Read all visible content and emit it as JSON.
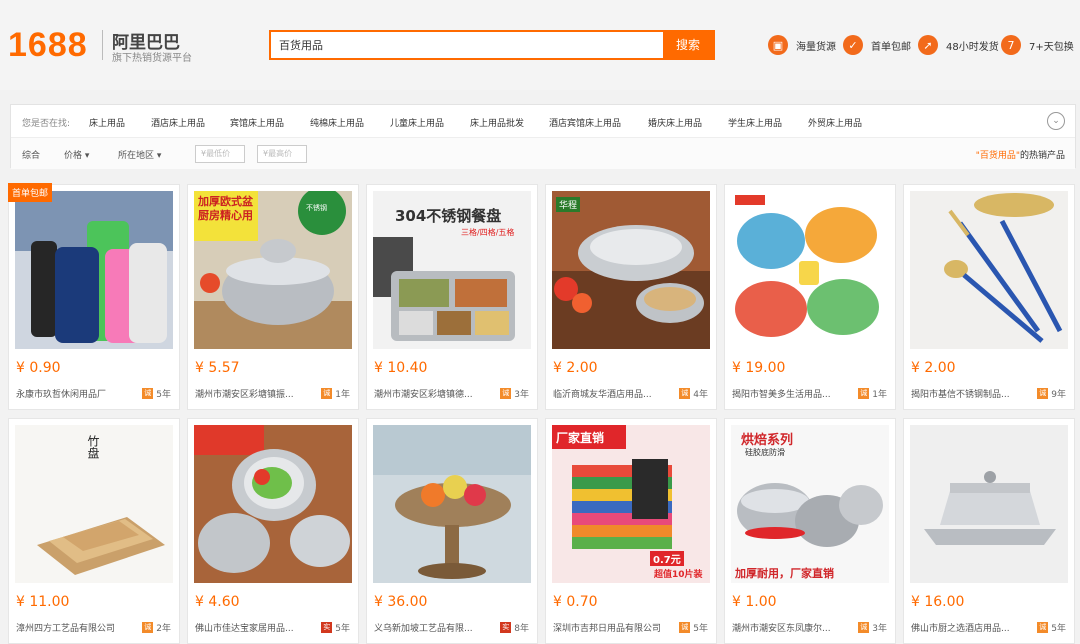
{
  "header": {
    "logo_num": "1688",
    "logo_cn": "阿里巴巴",
    "logo_sub": "旗下热销货源平台",
    "search_value": "百货用品",
    "search_button": "搜索",
    "services": [
      {
        "icon": "box-icon",
        "glyph": "▣",
        "label": "海量货源"
      },
      {
        "icon": "package-icon",
        "glyph": "✓",
        "label": "首单包邮"
      },
      {
        "icon": "rocket-icon",
        "glyph": "➚",
        "label": "48小时发货"
      },
      {
        "icon": "return-icon",
        "glyph": "7",
        "label": "7+天包换"
      }
    ]
  },
  "filters": {
    "crumb_label": "您是否在找:",
    "crumbs": [
      "床上用品",
      "酒店床上用品",
      "宾馆床上用品",
      "纯棉床上用品",
      "儿童床上用品",
      "床上用品批发",
      "酒店宾馆床上用品",
      "婚庆床上用品",
      "学生床上用品",
      "外贸床上用品"
    ],
    "sort": {
      "all": "综合",
      "price": "价格",
      "region": "所在地区"
    },
    "price_min_placeholder": "¥最低价",
    "price_max_placeholder": "¥最高价",
    "dash": "-",
    "hot_prefix": "\"百货用品\"",
    "hot_suffix": "的热销产品"
  },
  "ribbon": "首单包邮",
  "products": [
    {
      "price": "¥ 0.90",
      "seller": "永康市玖哲休闲用品厂",
      "years": "5年",
      "badge": "诚",
      "red": false
    },
    {
      "price": "¥ 5.57",
      "seller": "潮州市潮安区彩塘镇振...",
      "years": "1年",
      "badge": "诚",
      "red": false
    },
    {
      "price": "¥ 10.40",
      "seller": "潮州市潮安区彩塘镇德...",
      "years": "3年",
      "badge": "诚",
      "red": false
    },
    {
      "price": "¥ 2.00",
      "seller": "临沂商城友华酒店用品...",
      "years": "4年",
      "badge": "诚",
      "red": false
    },
    {
      "price": "¥ 19.00",
      "seller": "揭阳市智美多生活用品...",
      "years": "1年",
      "badge": "诚",
      "red": false
    },
    {
      "price": "¥ 2.00",
      "seller": "揭阳市基信不锈钢制品...",
      "years": "9年",
      "badge": "诚",
      "red": false
    },
    {
      "price": "¥ 11.00",
      "seller": "漳州四方工艺品有限公司",
      "years": "2年",
      "badge": "诚",
      "red": false
    },
    {
      "price": "¥ 4.60",
      "seller": "佛山市佳达宝家居用品...",
      "years": "5年",
      "badge": "实",
      "red": true
    },
    {
      "price": "¥ 36.00",
      "seller": "义乌新加坡工艺品有限...",
      "years": "8年",
      "badge": "实",
      "red": true
    },
    {
      "price": "¥ 0.70",
      "seller": "深圳市吉邦日用品有限公司",
      "years": "5年",
      "badge": "诚",
      "red": false
    },
    {
      "price": "¥ 1.00",
      "seller": "潮州市潮安区东凤康尔...",
      "years": "3年",
      "badge": "诚",
      "red": false
    },
    {
      "price": "¥ 16.00",
      "seller": "佛山市厨之选酒店用品...",
      "years": "5年",
      "badge": "诚",
      "red": false
    }
  ],
  "image_text": {
    "p2_title": "加厚欧式盆",
    "p2_sub": "厨房精心用",
    "p2_circle": "不锈钢",
    "p3_title": "304不锈钢餐盘",
    "p3_sub": "三格/四格/五格",
    "p4_tag": "华程",
    "p7_title": "竹盘",
    "p10_title": "厂家直销",
    "p10_price": "0.7元",
    "p10_sub": "超值10片装",
    "p11_title": "烘焙系列",
    "p11_sub": "硅胶底防滑",
    "p11_bottom": "加厚耐用，厂家直销"
  }
}
